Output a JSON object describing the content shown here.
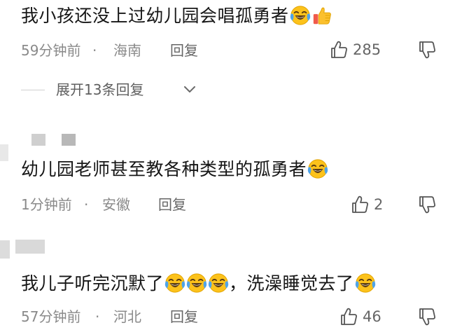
{
  "comments": [
    {
      "text": "我小孩还没上过幼儿园会唱孤勇者",
      "emojis": [
        "laugh-cry-emoji",
        "thumbs-up-emoji"
      ],
      "time": "59分钟前",
      "separator": "·",
      "location": "海南",
      "reply_label": "回复",
      "likes": "285"
    },
    {
      "text": "幼儿园老师甚至教各种类型的孤勇者",
      "emojis": [
        "laugh-cry-emoji"
      ],
      "time": "1分钟前",
      "separator": "·",
      "location": "安徽",
      "reply_label": "回复",
      "likes": "2"
    },
    {
      "text_before": "我儿子听完沉默了",
      "text_after": "，洗澡睡觉去了",
      "emojis": [
        "laugh-cry-emoji",
        "laugh-cry-emoji",
        "laugh-cry-emoji",
        "laugh-cry-emoji"
      ],
      "time": "57分钟前",
      "separator": "·",
      "location": "河北",
      "reply_label": "回复",
      "likes": "46"
    }
  ],
  "expand_replies": {
    "label": "展开13条回复"
  },
  "colors": {
    "text": "#161616",
    "meta": "#8a8a8a",
    "emoji_face": "#fcc21b",
    "thumb": "#f05a4a"
  }
}
